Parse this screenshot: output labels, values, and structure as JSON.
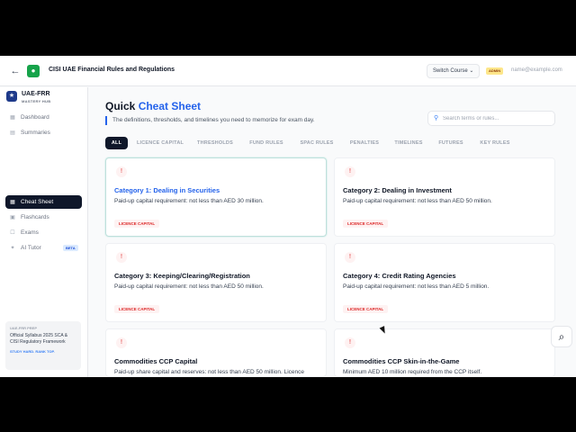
{
  "topbar": {
    "title": "CISI UAE Financial Rules and Regulations",
    "switch_course": "Switch Course",
    "admin_badge": "ADMIN",
    "email": "name@example.com"
  },
  "sidebar": {
    "brand_name": "UAE-FRR",
    "brand_sub": "MASTERY HUB",
    "items": [
      {
        "label": "Dashboard",
        "icon": "grid-icon"
      },
      {
        "label": "Summaries",
        "icon": "book-icon"
      },
      {
        "label": "Cheat Sheet",
        "icon": "sheet-icon"
      },
      {
        "label": "Flashcards",
        "icon": "cards-icon"
      },
      {
        "label": "Exams",
        "icon": "exam-icon"
      },
      {
        "label": "AI Tutor",
        "icon": "sparkle-icon"
      }
    ],
    "beta": "BETA",
    "promo": {
      "kicker": "UAE-FRR PREP",
      "text": "Official Syllabus 2025 SCA & CISI Regulatory Framework",
      "foot": "STUDY HARD. RANK TOP."
    }
  },
  "main": {
    "title_plain": "Quick ",
    "title_accent": "Cheat Sheet",
    "subtitle": "The definitions, thresholds, and timelines you need to memorize for exam day.",
    "search_placeholder": "Search terms or rules...",
    "tabs": [
      "ALL",
      "LICENCE CAPITAL",
      "THRESHOLDS",
      "FUND RULES",
      "SPAC RULES",
      "PENALTIES",
      "TIMELINES",
      "FUTURES",
      "KEY RULES"
    ],
    "cards": [
      {
        "title": "Category 1: Dealing in Securities",
        "text": "Paid-up capital requirement: not less than AED 30 million.",
        "tag": "LICENCE CAPITAL"
      },
      {
        "title": "Category 2: Dealing in Investment",
        "text": "Paid-up capital requirement: not less than AED 50 million.",
        "tag": "LICENCE CAPITAL"
      },
      {
        "title": "Category 3: Keeping/Clearing/Registration",
        "text": "Paid-up capital requirement: not less than AED 50 million.",
        "tag": "LICENCE CAPITAL"
      },
      {
        "title": "Category 4: Credit Rating Agencies",
        "text": "Paid-up capital requirement: not less than AED 5 million.",
        "tag": "LICENCE CAPITAL"
      },
      {
        "title": "Commodities CCP Capital",
        "text": "Paid-up share capital and reserves: not less than AED 50 million. Licence",
        "tag": ""
      },
      {
        "title": "Commodities CCP Skin-in-the-Game",
        "text": "Minimum AED 10 million required from the CCP itself.",
        "tag": ""
      }
    ]
  }
}
